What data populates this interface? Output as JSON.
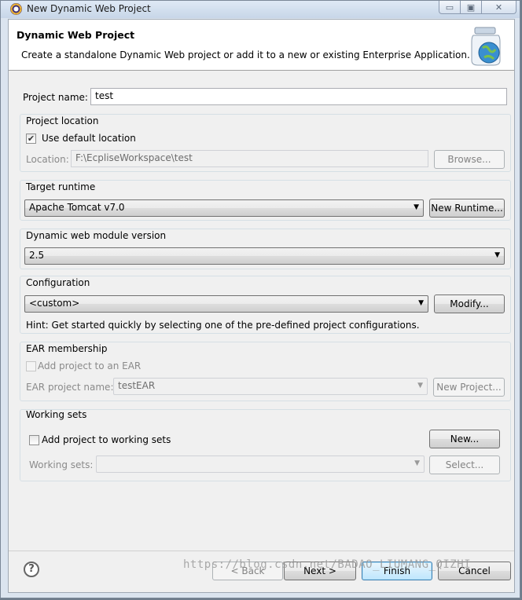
{
  "window": {
    "title": "New Dynamic Web Project",
    "minimize_glyph": "▭",
    "maximize_glyph": "▣",
    "close_glyph": "✕"
  },
  "header": {
    "title": "Dynamic Web Project",
    "description": "Create a standalone Dynamic Web project or add it to a new or existing Enterprise Application.",
    "icon": "web-project-jar-icon"
  },
  "project": {
    "name_label": "Project name:",
    "name_value": "test"
  },
  "location": {
    "group_label": "Project location",
    "use_default_label": "Use default location",
    "use_default_checked": true,
    "location_label": "Location:",
    "location_value": "F:\\EcpliseWorkspace\\test",
    "browse_label": "Browse..."
  },
  "runtime": {
    "group_label": "Target runtime",
    "selected": "Apache Tomcat v7.0",
    "new_runtime_label": "New Runtime..."
  },
  "module_version": {
    "group_label": "Dynamic web module version",
    "selected": "2.5"
  },
  "configuration": {
    "group_label": "Configuration",
    "selected": "<custom>",
    "modify_label": "Modify...",
    "hint": "Hint: Get started quickly by selecting one of the pre-defined project configurations."
  },
  "ear": {
    "group_label": "EAR membership",
    "add_label": "Add project to an EAR",
    "add_checked": false,
    "name_label": "EAR project name:",
    "name_value": "testEAR",
    "new_project_label": "New Project..."
  },
  "working_sets": {
    "group_label": "Working sets",
    "add_label": "Add project to working sets",
    "add_checked": false,
    "new_label": "New...",
    "sets_label": "Working sets:",
    "sets_value": "",
    "select_label": "Select..."
  },
  "footer": {
    "help_glyph": "?",
    "back_label": "< Back",
    "next_label": "Next >",
    "finish_label": "Finish",
    "cancel_label": "Cancel"
  },
  "watermark": "https://blog.csdn.net/BADAO_LIUMANG_QIZHI",
  "check_glyph": "✔",
  "arrow_glyph": "▼"
}
